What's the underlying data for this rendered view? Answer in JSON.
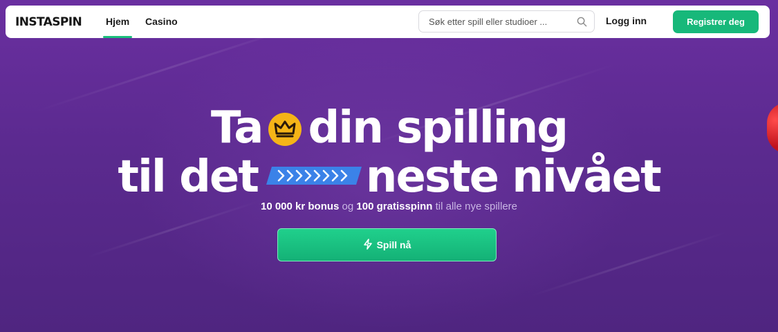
{
  "header": {
    "logo_text": "INSTASPIN",
    "tabs": [
      {
        "label": "Hjem",
        "active": true
      },
      {
        "label": "Casino",
        "active": false
      }
    ],
    "search": {
      "placeholder": "Søk etter spill eller studioer ...",
      "value": ""
    },
    "login_label": "Logg inn",
    "register_label": "Registrer deg"
  },
  "hero": {
    "line1_before": "Ta",
    "line1_after": "din spilling",
    "line2_before": "til det",
    "line2_after": "neste nivået",
    "subtitle_bonus": "10 000 kr bonus",
    "subtitle_and": "og",
    "subtitle_spins": "100 gratisspinn",
    "subtitle_rest": "til alle nye spillere",
    "cta_label": "Spill nå"
  },
  "colors": {
    "background": "#5a2a8c",
    "accent_green": "#17b87a",
    "crown_yellow": "#f5b417",
    "chevron_blue": "#3b82e8"
  },
  "icons": [
    "search-icon",
    "crown-icon",
    "chevrons-icon",
    "lightning-icon"
  ]
}
